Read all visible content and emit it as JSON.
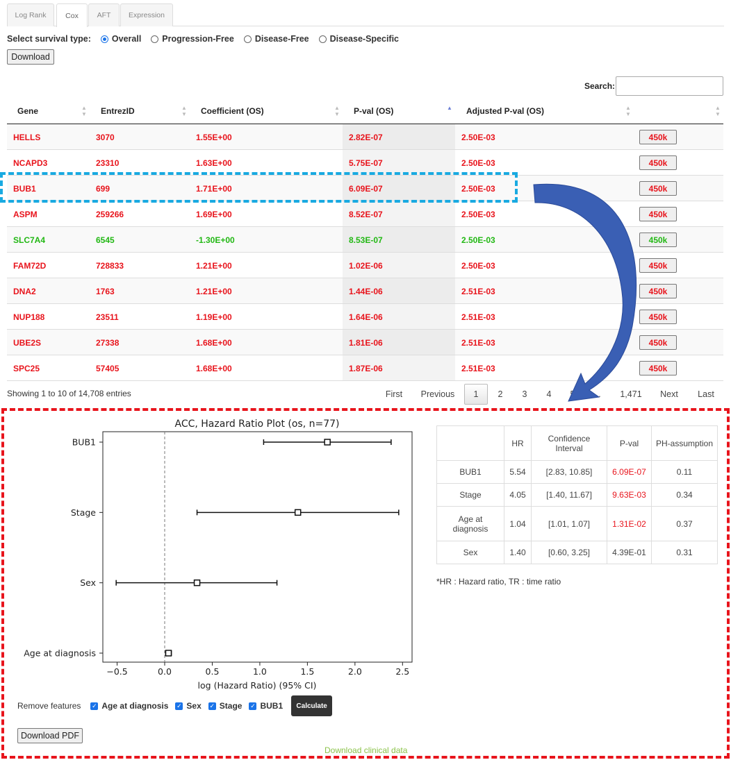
{
  "tabs": [
    "Log Rank",
    "Cox",
    "AFT",
    "Expression"
  ],
  "survival": {
    "label": "Select survival type:",
    "options": [
      "Overall",
      "Progression-Free",
      "Disease-Free",
      "Disease-Specific"
    ],
    "selected": "Overall"
  },
  "download_label": "Download",
  "search": {
    "label": "Search:",
    "value": ""
  },
  "table": {
    "headers": [
      "Gene",
      "EntrezID",
      "Coefficient (OS)",
      "P-val (OS)",
      "Adjusted P-val (OS)",
      ""
    ],
    "sorted_column": "P-val (OS)",
    "rows": [
      {
        "gene": "HELLS",
        "entrez": "3070",
        "coef": "1.55E+00",
        "pval": "2.82E-07",
        "adj": "2.50E-03",
        "btn": "450k",
        "color": "red"
      },
      {
        "gene": "NCAPD3",
        "entrez": "23310",
        "coef": "1.63E+00",
        "pval": "5.75E-07",
        "adj": "2.50E-03",
        "btn": "450k",
        "color": "red"
      },
      {
        "gene": "BUB1",
        "entrez": "699",
        "coef": "1.71E+00",
        "pval": "6.09E-07",
        "adj": "2.50E-03",
        "btn": "450k",
        "color": "red"
      },
      {
        "gene": "ASPM",
        "entrez": "259266",
        "coef": "1.69E+00",
        "pval": "8.52E-07",
        "adj": "2.50E-03",
        "btn": "450k",
        "color": "red"
      },
      {
        "gene": "SLC7A4",
        "entrez": "6545",
        "coef": "-1.30E+00",
        "pval": "8.53E-07",
        "adj": "2.50E-03",
        "btn": "450k",
        "color": "green"
      },
      {
        "gene": "FAM72D",
        "entrez": "728833",
        "coef": "1.21E+00",
        "pval": "1.02E-06",
        "adj": "2.50E-03",
        "btn": "450k",
        "color": "red"
      },
      {
        "gene": "DNA2",
        "entrez": "1763",
        "coef": "1.21E+00",
        "pval": "1.44E-06",
        "adj": "2.51E-03",
        "btn": "450k",
        "color": "red"
      },
      {
        "gene": "NUP188",
        "entrez": "23511",
        "coef": "1.19E+00",
        "pval": "1.64E-06",
        "adj": "2.51E-03",
        "btn": "450k",
        "color": "red"
      },
      {
        "gene": "UBE2S",
        "entrez": "27338",
        "coef": "1.68E+00",
        "pval": "1.81E-06",
        "adj": "2.51E-03",
        "btn": "450k",
        "color": "red"
      },
      {
        "gene": "SPC25",
        "entrez": "57405",
        "coef": "1.68E+00",
        "pval": "1.87E-06",
        "adj": "2.51E-03",
        "btn": "450k",
        "color": "red"
      }
    ]
  },
  "info": "Showing 1 to 10 of 14,708 entries",
  "pagination": {
    "first": "First",
    "previous": "Previous",
    "pages": [
      "1",
      "2",
      "3",
      "4",
      "5",
      "…",
      "1,471"
    ],
    "current": "1",
    "next": "Next",
    "last": "Last"
  },
  "chart_data": {
    "type": "forest",
    "title": "ACC, Hazard Ratio Plot (os, n=77)",
    "xlabel": "log (Hazard Ratio) (95% CI)",
    "ylabel": "",
    "xlim": [
      -0.65,
      2.6
    ],
    "xticks": [
      -0.5,
      0.0,
      0.5,
      1.0,
      1.5,
      2.0,
      2.5
    ],
    "xtick_labels": [
      "−0.5",
      "0.0",
      "0.5",
      "1.0",
      "1.5",
      "2.0",
      "2.5"
    ],
    "reference_line": 0,
    "categories": [
      "BUB1",
      "Stage",
      "Sex",
      "Age at diagnosis"
    ],
    "points": [
      {
        "label": "BUB1",
        "value": 1.71,
        "low": 1.04,
        "high": 2.38
      },
      {
        "label": "Stage",
        "value": 1.4,
        "low": 0.34,
        "high": 2.46
      },
      {
        "label": "Sex",
        "value": 0.34,
        "low": -0.51,
        "high": 1.18
      },
      {
        "label": "Age at diagnosis",
        "value": 0.04,
        "low": 0.01,
        "high": 0.07
      }
    ]
  },
  "hr_table": {
    "headers": [
      "",
      "HR",
      "Confidence Interval",
      "P-val",
      "PH-assumption"
    ],
    "rows": [
      {
        "feature": "BUB1",
        "hr": "5.54",
        "ci": "[2.83, 10.85]",
        "pval": "6.09E-07",
        "ph": "0.11",
        "significant": true
      },
      {
        "feature": "Stage",
        "hr": "4.05",
        "ci": "[1.40, 11.67]",
        "pval": "9.63E-03",
        "ph": "0.34",
        "significant": true
      },
      {
        "feature": "Age at diagnosis",
        "hr": "1.04",
        "ci": "[1.01, 1.07]",
        "pval": "1.31E-02",
        "ph": "0.37",
        "significant": true
      },
      {
        "feature": "Sex",
        "hr": "1.40",
        "ci": "[0.60, 3.25]",
        "pval": "4.39E-01",
        "ph": "0.31",
        "significant": false
      }
    ]
  },
  "footnote": "*HR : Hazard ratio, TR : time ratio",
  "remove_features": {
    "label": "Remove features",
    "items": [
      "Age at diagnosis",
      "Sex",
      "Stage",
      "BUB1"
    ],
    "calculate": "Calculate"
  },
  "download_pdf": "Download PDF",
  "download_clinical": "Download clinical data",
  "colors": {
    "red": "#e8141c",
    "green": "#22b814",
    "highlight_blue": "#19aae1",
    "arrow_blue": "#3a5fb4",
    "link_green": "#8bc34a"
  }
}
